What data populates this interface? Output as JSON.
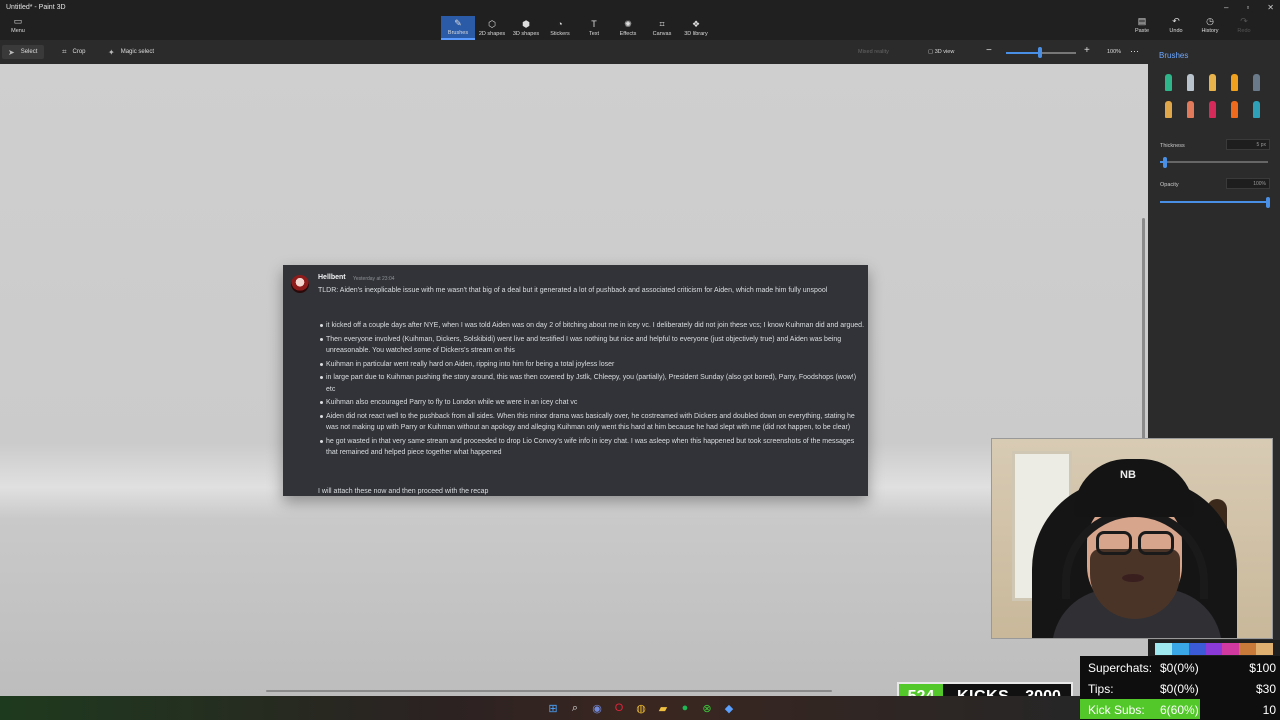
{
  "app": {
    "title": "Untitled* - Paint 3D",
    "menu_label": "Menu"
  },
  "toolbar": {
    "tabs": [
      {
        "label": "Brushes",
        "icon": "brush-icon",
        "glyph": "✎",
        "active": true
      },
      {
        "label": "2D shapes",
        "icon": "2d-shapes-icon",
        "glyph": "⬡",
        "active": false
      },
      {
        "label": "3D shapes",
        "icon": "3d-shapes-icon",
        "glyph": "⬢",
        "active": false
      },
      {
        "label": "Stickers",
        "icon": "stickers-icon",
        "glyph": "◔",
        "active": false
      },
      {
        "label": "Text",
        "icon": "text-icon",
        "glyph": "T",
        "active": false
      },
      {
        "label": "Effects",
        "icon": "effects-icon",
        "glyph": "✺",
        "active": false
      },
      {
        "label": "Canvas",
        "icon": "canvas-icon",
        "glyph": "⌗",
        "active": false
      },
      {
        "label": "3D library",
        "icon": "3d-library-icon",
        "glyph": "❖",
        "active": false
      }
    ],
    "paste": "Paste",
    "undo": "Undo",
    "history": "History",
    "redo": "Redo"
  },
  "subbar": {
    "select": "Select",
    "crop": "Crop",
    "magic_select": "Magic select",
    "mixed_reality": "Mixed reality",
    "view_3d": "3D view",
    "zoom": "100%",
    "zoom_fraction": 0.49
  },
  "panel": {
    "title": "Brushes",
    "thickness_label": "Thickness",
    "thickness_value": "5 px",
    "thickness_fraction": 0.05,
    "opacity_label": "Opacity",
    "opacity_value": "100%",
    "opacity_fraction": 1.0,
    "brushes": [
      {
        "name": "marker-brush-icon",
        "color": "#2fb58a"
      },
      {
        "name": "calligraphy-pen-icon",
        "color": "#b9c3cc"
      },
      {
        "name": "oil-brush-icon",
        "color": "#e8b34a"
      },
      {
        "name": "watercolor-brush-icon",
        "color": "#f0a21e"
      },
      {
        "name": "pixel-pen-icon",
        "color": "#6b7a8a"
      },
      {
        "name": "pencil-icon",
        "color": "#e0a64a"
      },
      {
        "name": "eraser-icon",
        "color": "#e07a5a"
      },
      {
        "name": "crayon-icon",
        "color": "#d62a5a"
      },
      {
        "name": "spray-can-icon",
        "color": "#f06a1e"
      },
      {
        "name": "fill-bucket-icon",
        "color": "#2ea0b8"
      }
    ]
  },
  "message": {
    "username": "Hellbent",
    "timestamp": "Yesterday at 23:04",
    "intro": "TLDR: Aiden's inexplicable issue with me wasn't that big of a deal but it generated a lot of pushback and associated criticism for Aiden, which made him fully unspool",
    "bullets": [
      "it kicked off a couple days after NYE, when I was told Aiden was on day 2 of bitching about me in icey vc. I deliberately did not join these vcs; I know Kuihman did and argued.",
      "Then everyone involved (Kuihman, Dickers, Solskibidi) went live and testified I was nothing but nice and helpful to everyone (just objectively true) and Aiden was being unreasonable. You watched some of Dickers's stream on this",
      "Kuihman in particular went really hard on Aiden, ripping into him for being a total joyless loser",
      "in large part due to Kuihman pushing the story around, this was then covered by Jstlk, Chleepy, you (partially), President Sunday (also got bored), Parry, Foodshops (wow!) etc",
      "Kuihman also encouraged Parry to fly to London while we were in an icey chat vc",
      "Aiden did not react well to the pushback from all sides. When this minor drama was basically over, he costreamed with Dickers and doubled down on everything, stating he was not making up with Parry or Kuihman without an apology and alleging Kuihman only went this hard at him because he had slept with me (did not happen, to be clear)",
      "he got wasted in that very same stream and proceeded to drop Lio Convoy's wife info in icey chat. I was asleep when this happened but took screenshots of the messages that remained and helped piece together what happened"
    ],
    "outro": "I will attach these now and then proceed with the recap"
  },
  "overlay": {
    "kicks_count": "524",
    "kicks_label": "KICKS",
    "kicks_goal": "3000",
    "superchats_label": "Superchats:",
    "superchats_value": "$0(0%)",
    "superchats_goal": "$100",
    "tips_label": "Tips:",
    "tips_value": "$0(0%)",
    "tips_goal": "$30",
    "kicksubs_label": "Kick Subs:",
    "kicksubs_value": "6(60%)",
    "kicksubs_goal": "10",
    "strip_colors": [
      "#9fe8f0",
      "#3aa7e6",
      "#3a5ad6",
      "#8a3ad6",
      "#d03aa0",
      "#c87a3a",
      "#e0b070"
    ]
  },
  "taskbar": {
    "icons": [
      {
        "name": "windows-start-icon",
        "glyph": "⊞",
        "color": "#4aa3ff"
      },
      {
        "name": "search-icon",
        "glyph": "⌕",
        "color": "#dddddd"
      },
      {
        "name": "discord-icon",
        "glyph": "◉",
        "color": "#7289da"
      },
      {
        "name": "opera-icon",
        "glyph": "O",
        "color": "#e0243a"
      },
      {
        "name": "chrome-icon",
        "glyph": "◍",
        "color": "#e8b830"
      },
      {
        "name": "file-explorer-icon",
        "glyph": "▰",
        "color": "#f0c040"
      },
      {
        "name": "spotify-icon",
        "glyph": "●",
        "color": "#1db954"
      },
      {
        "name": "xbox-icon",
        "glyph": "⊗",
        "color": "#3ac83a"
      },
      {
        "name": "paint3d-icon",
        "glyph": "◆",
        "color": "#5aa0ff"
      }
    ]
  }
}
